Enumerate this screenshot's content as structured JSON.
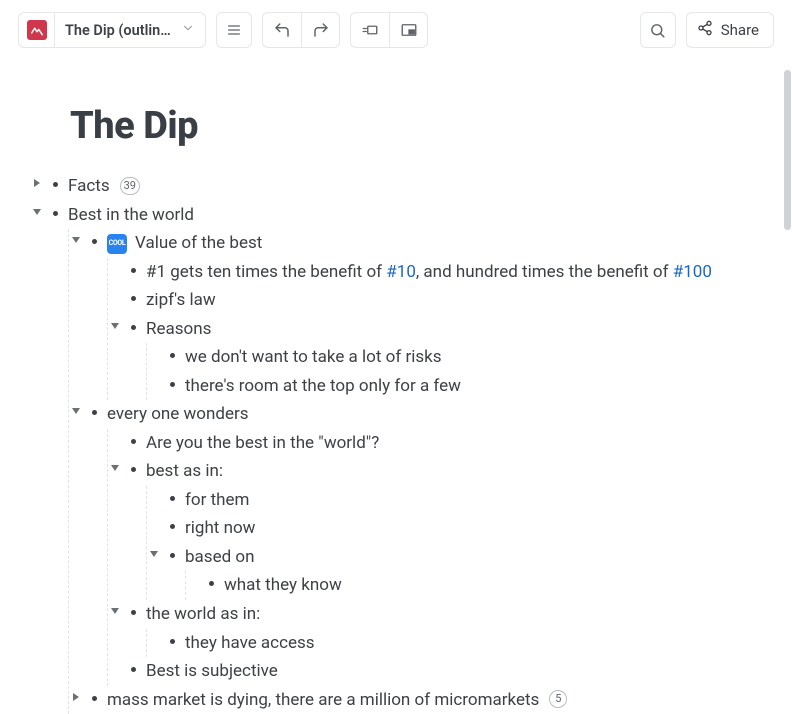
{
  "toolbar": {
    "title": "The Dip (outline...",
    "share_label": "Share"
  },
  "heading": "The Dip",
  "icon_cool_label": "COOL",
  "outline": {
    "facts": {
      "label": "Facts",
      "badge": "39"
    },
    "best_world": {
      "label": "Best in the world"
    },
    "value_best": {
      "label": "Value of the best"
    },
    "line1_a": "#1 gets ten times the benefit of ",
    "line1_link1": "#10",
    "line1_b": ", and hundred times the benefit of ",
    "line1_link2": "#100",
    "zipfs": "zipf's law",
    "reasons": {
      "label": "Reasons"
    },
    "reason1": "we don't want to take a lot of risks",
    "reason2": "there's room at the top only for a few",
    "every_wonders": {
      "label": "every one wonders"
    },
    "are_you": "Are you the best in the \"world\"?",
    "best_as_in": {
      "label": "best as in:"
    },
    "for_them": "for them",
    "right_now": "right now",
    "based_on": {
      "label": "based on"
    },
    "what_they_know": "what they know",
    "world_as_in": {
      "label": "the world as in:"
    },
    "have_access": "they have access",
    "best_subjective": "Best is subjective",
    "mass_market": {
      "label": "mass market is dying, there are a million of micromarkets",
      "badge": "5"
    }
  }
}
